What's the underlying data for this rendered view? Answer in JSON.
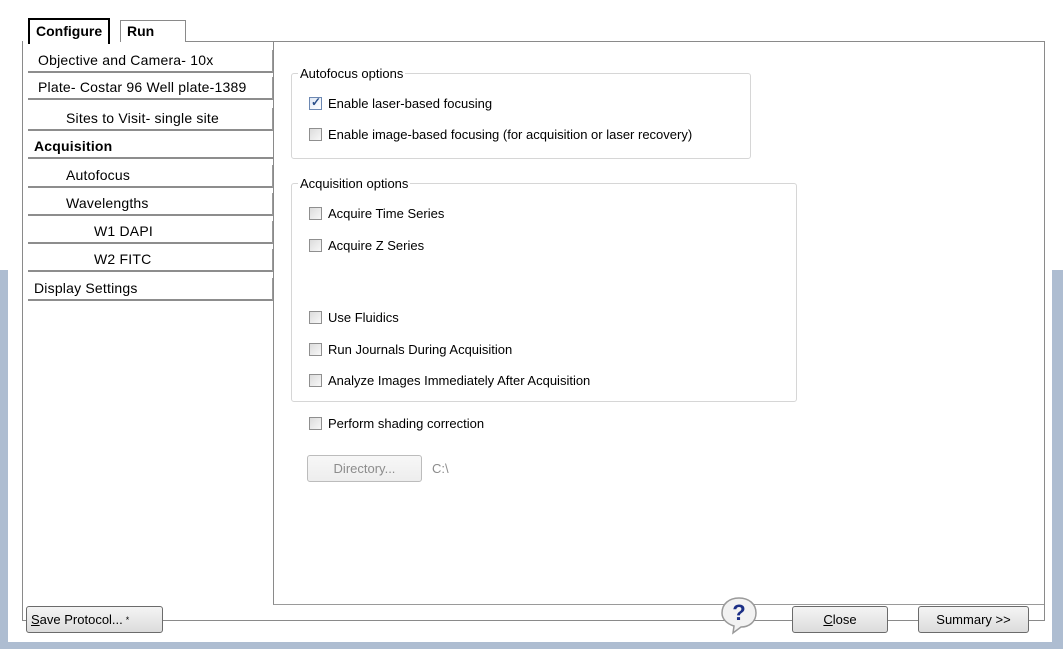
{
  "tabs": [
    {
      "label": "Configure",
      "active": true
    },
    {
      "label": "Run",
      "active": false
    }
  ],
  "nav": {
    "objective": "Objective and Camera- 10x",
    "plate": "Plate- Costar 96 Well plate-1389",
    "sites": "Sites to Visit- single site",
    "acquisition": "Acquisition",
    "autofocus": "Autofocus",
    "wavelengths": "Wavelengths",
    "w1": "W1 DAPI",
    "w2": "W2 FITC",
    "display": "Display Settings"
  },
  "autofocus_group": {
    "title": "Autofocus options",
    "laser": {
      "label": "Enable laser-based focusing",
      "checked": true
    },
    "image": {
      "label": "Enable image-based focusing (for acquisition or laser recovery)",
      "checked": false
    }
  },
  "acquisition_group": {
    "title": "Acquisition options",
    "time_series": {
      "label": "Acquire Time Series",
      "checked": false
    },
    "z_series": {
      "label": "Acquire Z Series",
      "checked": false
    },
    "fluidics": {
      "label": "Use Fluidics",
      "checked": false
    },
    "journals": {
      "label": "Run Journals During Acquisition",
      "checked": false
    },
    "analyze": {
      "label": "Analyze Images Immediately After Acquisition",
      "checked": false
    }
  },
  "shading": {
    "label": "Perform shading correction",
    "checked": false
  },
  "directory": {
    "button_label": "Directory...",
    "path": "C:\\"
  },
  "footer": {
    "save_label_underlined": "S",
    "save_label_rest": "ave Protocol...",
    "save_mark": "*",
    "close_label_underlined": "C",
    "close_label_rest": "lose",
    "summary_label": "Summary >>"
  },
  "icons": {
    "help": "help-question-icon",
    "check": "checkmark-icon"
  },
  "colors": {
    "outer_frame": "#aebdd1",
    "border": "#8a8a8a",
    "group_border": "#d6d6d6",
    "disabled_text": "#8c8c8c"
  }
}
